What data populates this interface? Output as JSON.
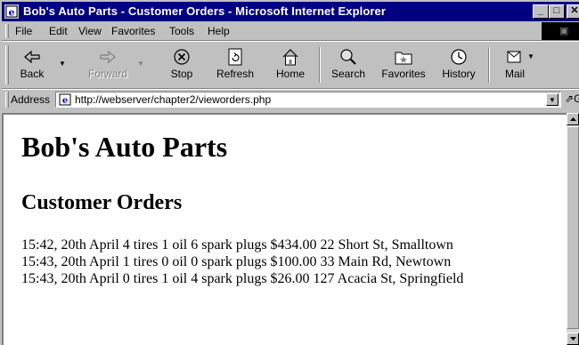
{
  "window": {
    "title": "Bob's Auto Parts - Customer Orders - Microsoft Internet Explorer",
    "title_color": "#000080",
    "buttons": {
      "minimize": "_",
      "maximize": "□",
      "close": "✕"
    }
  },
  "menubar": {
    "items": [
      {
        "label": "File"
      },
      {
        "label": "Edit"
      },
      {
        "label": "View"
      },
      {
        "label": "Favorites"
      },
      {
        "label": "Tools"
      },
      {
        "label": "Help"
      }
    ]
  },
  "toolbar": {
    "buttons": [
      {
        "label": "Back",
        "icon": "back-arrow-icon",
        "enabled": true
      },
      {
        "label": "Forward",
        "icon": "forward-arrow-icon",
        "enabled": false
      },
      {
        "label": "Stop",
        "icon": "stop-icon",
        "enabled": true
      },
      {
        "label": "Refresh",
        "icon": "refresh-icon",
        "enabled": true
      },
      {
        "label": "Home",
        "icon": "home-icon",
        "enabled": true
      },
      {
        "label": "Search",
        "icon": "search-icon",
        "enabled": true
      },
      {
        "label": "Favorites",
        "icon": "favorites-icon",
        "enabled": true
      },
      {
        "label": "History",
        "icon": "history-icon",
        "enabled": true
      },
      {
        "label": "Mail",
        "icon": "mail-icon",
        "enabled": true
      }
    ]
  },
  "address": {
    "label": "Address",
    "url": "http://webserver/chapter2/vieworders.php",
    "go_label": "Go"
  },
  "page": {
    "heading": "Bob's Auto Parts",
    "subheading": "Customer Orders",
    "orders": [
      "15:42, 20th April 4 tires 1 oil 6 spark plugs $434.00 22 Short St, Smalltown",
      "15:43, 20th April 1 tires 0 oil 0 spark plugs $100.00 33 Main Rd, Newtown",
      "15:43, 20th April 0 tires 1 oil 4 spark plugs $26.00 127 Acacia St, Springfield"
    ]
  }
}
